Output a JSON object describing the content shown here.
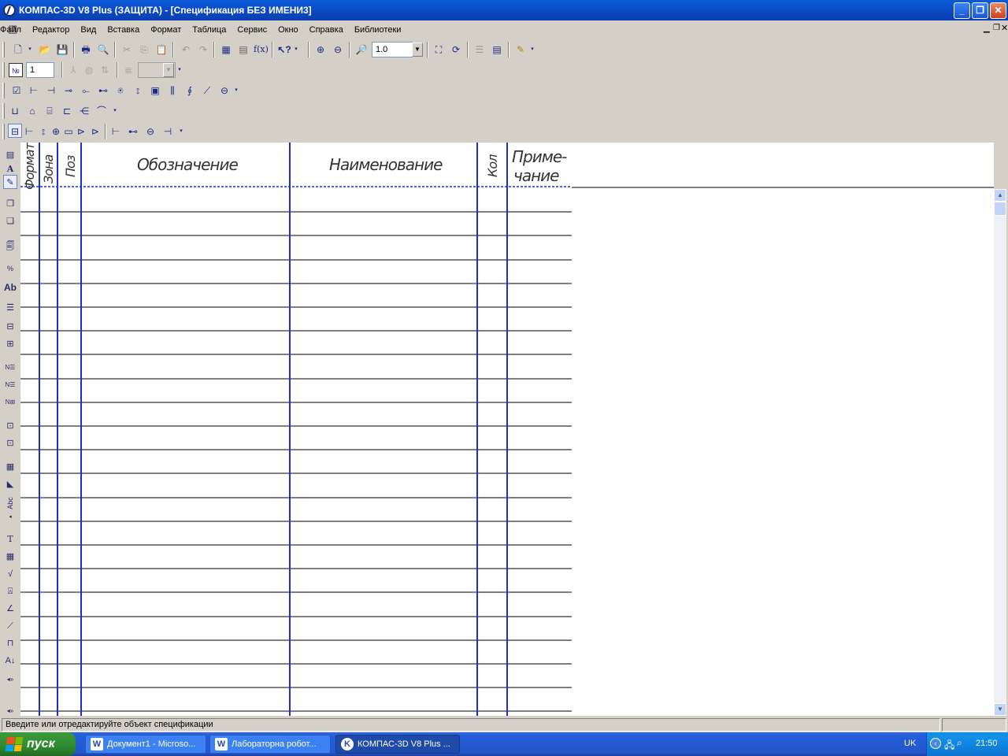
{
  "window": {
    "title": "КОМПАС-3D V8 Plus (ЗАЩИТА) - [Спецификация БЕЗ ИМЕНИ3]",
    "minimize_icon": "minimize-icon",
    "restore_icon": "restore-icon",
    "close_icon": "close-icon"
  },
  "menu": {
    "items": [
      "Файл",
      "Редактор",
      "Вид",
      "Вставка",
      "Формат",
      "Таблица",
      "Сервис",
      "Окно",
      "Справка",
      "Библиотеки"
    ]
  },
  "toolbar_standard": {
    "zoom_value": "1.0"
  },
  "toolbar_spec": {
    "position_value": "1",
    "style_value": ""
  },
  "spec_table": {
    "headers": {
      "format": "Формат",
      "zone": "Зона",
      "pos": "Поз",
      "designation": "Обозначение",
      "name": "Наименование",
      "qty": "Кол",
      "note_line1": "Приме-",
      "note_line2": "чание"
    },
    "row_count": 22
  },
  "status": {
    "message": "Введите или отредактируйте объект спецификации"
  },
  "taskbar": {
    "start_label": "пуск",
    "tasks": [
      {
        "label": "Документ1 - Microso..."
      },
      {
        "label": "Лабораторна  робот..."
      },
      {
        "label": "КОМПАС-3D V8 Plus ..."
      }
    ],
    "language": "UK",
    "clock": "21:50"
  },
  "colors": {
    "title_blue": "#0b49c4",
    "table_lines": "#1a2fd0",
    "taskbar_blue": "#245edb",
    "start_green": "#2f8b2f"
  }
}
